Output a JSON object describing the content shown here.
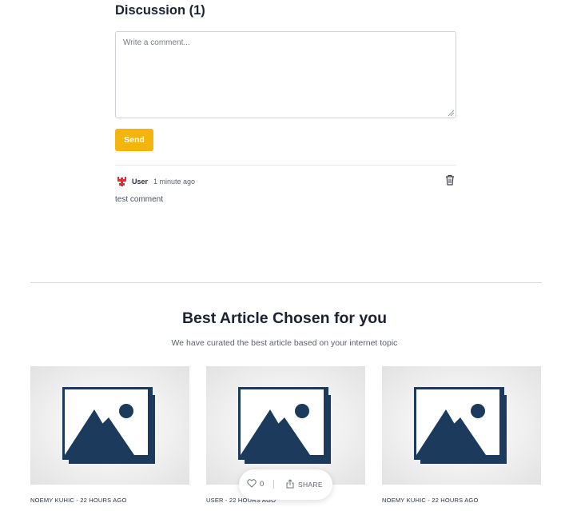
{
  "discussion": {
    "title": "Discussion (1)",
    "comment_placeholder": "Write a comment...",
    "send_label": "Send"
  },
  "comments": [
    {
      "user": "User",
      "time": "1 minute ago",
      "text": "test comment"
    }
  ],
  "best_articles": {
    "title": "Best Article Chosen for you",
    "subtitle": "We have curated the best article based on your internet topic",
    "cards": [
      {
        "meta": "NOEMY KUHIC - 22 HOURS AGO"
      },
      {
        "meta": "USER - 22 HOURS AGO"
      },
      {
        "meta": "NOEMY KUHIC - 22 HOURS AGO"
      }
    ]
  },
  "actions": {
    "like_count": "0",
    "share_label": "SHARE"
  },
  "colors": {
    "accent": "#f3b50a",
    "image_icon": "#1b3a5c",
    "avatar": "#e03030"
  },
  "icons": [
    "trash-icon",
    "avatar-icon",
    "image-placeholder-icon",
    "heart-icon",
    "share-icon"
  ]
}
